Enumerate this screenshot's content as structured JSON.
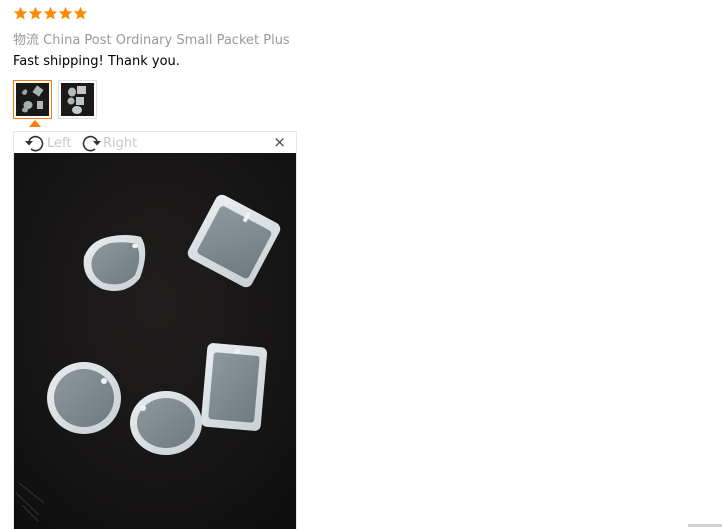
{
  "review": {
    "rating": 5,
    "rating_max": 5,
    "star_color": "#ff8a00",
    "shipping_prefix": "物流",
    "shipping_method": "China Post Ordinary Small Packet Plus",
    "text": "Fast shipping! Thank you."
  },
  "thumbnails": [
    {
      "name": "photo-1",
      "selected": true
    },
    {
      "name": "photo-2",
      "selected": false
    }
  ],
  "viewer": {
    "rotate_left_label": "Left",
    "rotate_right_label": "Right",
    "close_glyph": "×"
  },
  "colors": {
    "accent": "#ff7a00",
    "photo_background": "#161514"
  }
}
